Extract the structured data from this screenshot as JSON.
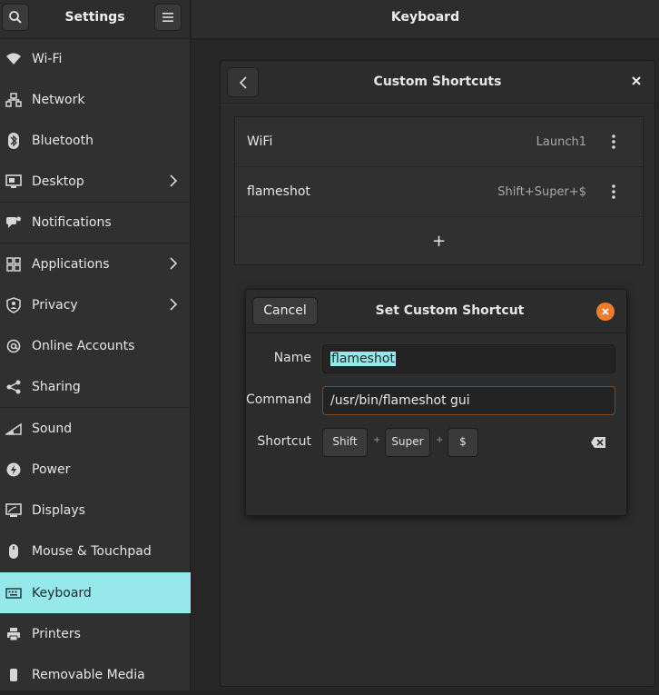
{
  "sidebar": {
    "title": "Settings",
    "items": [
      {
        "label": "Wi-Fi",
        "icon": "wifi-icon",
        "chevron": false
      },
      {
        "label": "Network",
        "icon": "network-icon",
        "chevron": false
      },
      {
        "label": "Bluetooth",
        "icon": "bluetooth-icon",
        "chevron": false
      },
      {
        "label": "Desktop",
        "icon": "desktop-icon",
        "chevron": true
      },
      {
        "label": "Notifications",
        "icon": "notifications-icon",
        "chevron": false
      },
      {
        "label": "Applications",
        "icon": "applications-icon",
        "chevron": true
      },
      {
        "label": "Privacy",
        "icon": "privacy-icon",
        "chevron": true
      },
      {
        "label": "Online Accounts",
        "icon": "online-accounts-icon",
        "chevron": false
      },
      {
        "label": "Sharing",
        "icon": "sharing-icon",
        "chevron": false
      },
      {
        "label": "Sound",
        "icon": "sound-icon",
        "chevron": false
      },
      {
        "label": "Power",
        "icon": "power-icon",
        "chevron": false
      },
      {
        "label": "Displays",
        "icon": "displays-icon",
        "chevron": false
      },
      {
        "label": "Mouse & Touchpad",
        "icon": "mouse-icon",
        "chevron": false
      },
      {
        "label": "Keyboard",
        "icon": "keyboard-icon",
        "chevron": false,
        "active": true
      },
      {
        "label": "Printers",
        "icon": "printer-icon",
        "chevron": false
      },
      {
        "label": "Removable Media",
        "icon": "removable-media-icon",
        "chevron": false
      }
    ]
  },
  "main": {
    "title": "Keyboard"
  },
  "custom_shortcuts": {
    "title": "Custom Shortcuts",
    "rows": [
      {
        "name": "WiFi",
        "accel": "Launch1"
      },
      {
        "name": "flameshot",
        "accel": "Shift+Super+$"
      }
    ],
    "add_label": "+"
  },
  "set_dialog": {
    "title": "Set Custom Shortcut",
    "cancel_label": "Cancel",
    "name_label": "Name",
    "name_value": "flameshot",
    "command_label": "Command",
    "command_value": "/usr/bin/flameshot gui",
    "shortcut_label": "Shortcut",
    "keys": [
      "Shift",
      "Super",
      "$"
    ],
    "plus": "+"
  },
  "colors": {
    "accent_selected": "#96e8ea",
    "close_orange": "#ed7c2d",
    "background": "#242424"
  }
}
